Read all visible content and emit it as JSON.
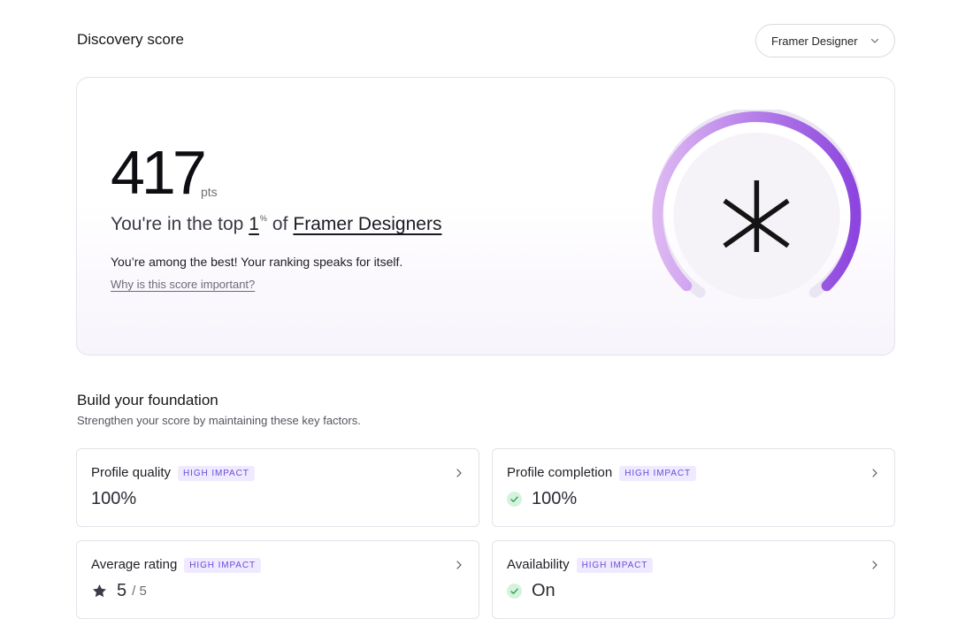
{
  "header": {
    "title": "Discovery score",
    "role_selector": {
      "selected": "Framer Designer"
    }
  },
  "score_card": {
    "score": "417",
    "unit": "pts",
    "rank_prefix": "You're in the top",
    "rank_percent": "1",
    "rank_percent_symbol": "%",
    "rank_middle": "of",
    "rank_group": "Framer Designers",
    "message": "You’re among the best! Your ranking speaks for itself.",
    "why_link": "Why is this score important?",
    "gauge": {
      "fill_fraction": 1.0,
      "gradient_start": "#ddb7f2",
      "gradient_end": "#8c45de"
    }
  },
  "foundation": {
    "title": "Build your foundation",
    "subtitle": "Strengthen your score by maintaining these key factors.",
    "factors": [
      {
        "name": "Profile quality",
        "badge": "HIGH IMPACT",
        "value": "100%"
      },
      {
        "name": "Profile completion",
        "badge": "HIGH IMPACT",
        "value": "100%",
        "icon": "check-icon"
      },
      {
        "name": "Average rating",
        "badge": "HIGH IMPACT",
        "value": "5",
        "denominator": "/ 5",
        "icon": "star-icon"
      },
      {
        "name": "Availability",
        "badge": "HIGH IMPACT",
        "value": "On",
        "icon": "check-icon"
      }
    ]
  },
  "colors": {
    "accent": "#6b4ad8",
    "badge_bg": "#efeaff",
    "check_bg": "#d5f2dd",
    "check": "#2f9e55"
  }
}
